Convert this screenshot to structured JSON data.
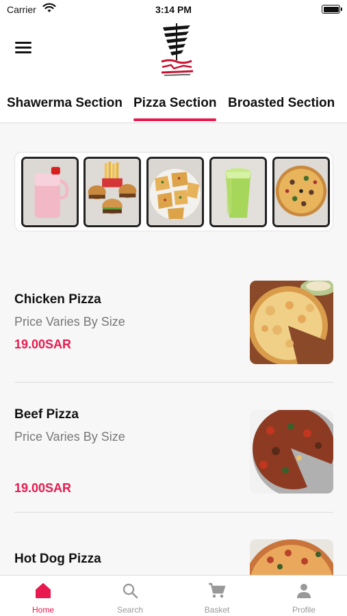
{
  "status_bar": {
    "carrier": "Carrier",
    "time": "3:14 PM"
  },
  "header": {
    "menu_icon": "hamburger-icon",
    "logo_icon": "shawarma-logo-icon"
  },
  "section_tabs": [
    {
      "label": "Shawerma Section",
      "active": false
    },
    {
      "label": "Pizza Section",
      "active": true
    },
    {
      "label": "Broasted Section",
      "active": false
    }
  ],
  "promo_images": [
    "drink-jug",
    "burgers-fries",
    "flatbread-platter",
    "green-juice",
    "pizza"
  ],
  "items": [
    {
      "name": "Chicken Pizza",
      "description": "Price Varies By Size",
      "price": "19.00SAR"
    },
    {
      "name": "Beef Pizza",
      "description": "Price Varies By Size",
      "price": "19.00SAR"
    },
    {
      "name": "Hot Dog Pizza",
      "description": "",
      "price": ""
    }
  ],
  "bottom_nav": [
    {
      "label": "Home",
      "icon": "home-icon",
      "active": true
    },
    {
      "label": "Search",
      "icon": "search-icon",
      "active": false
    },
    {
      "label": "Basket",
      "icon": "cart-icon",
      "active": false
    },
    {
      "label": "Profile",
      "icon": "profile-icon",
      "active": false
    }
  ],
  "colors": {
    "accent": "#e8194e",
    "muted_text": "#777777",
    "inactive_nav": "#999999"
  }
}
